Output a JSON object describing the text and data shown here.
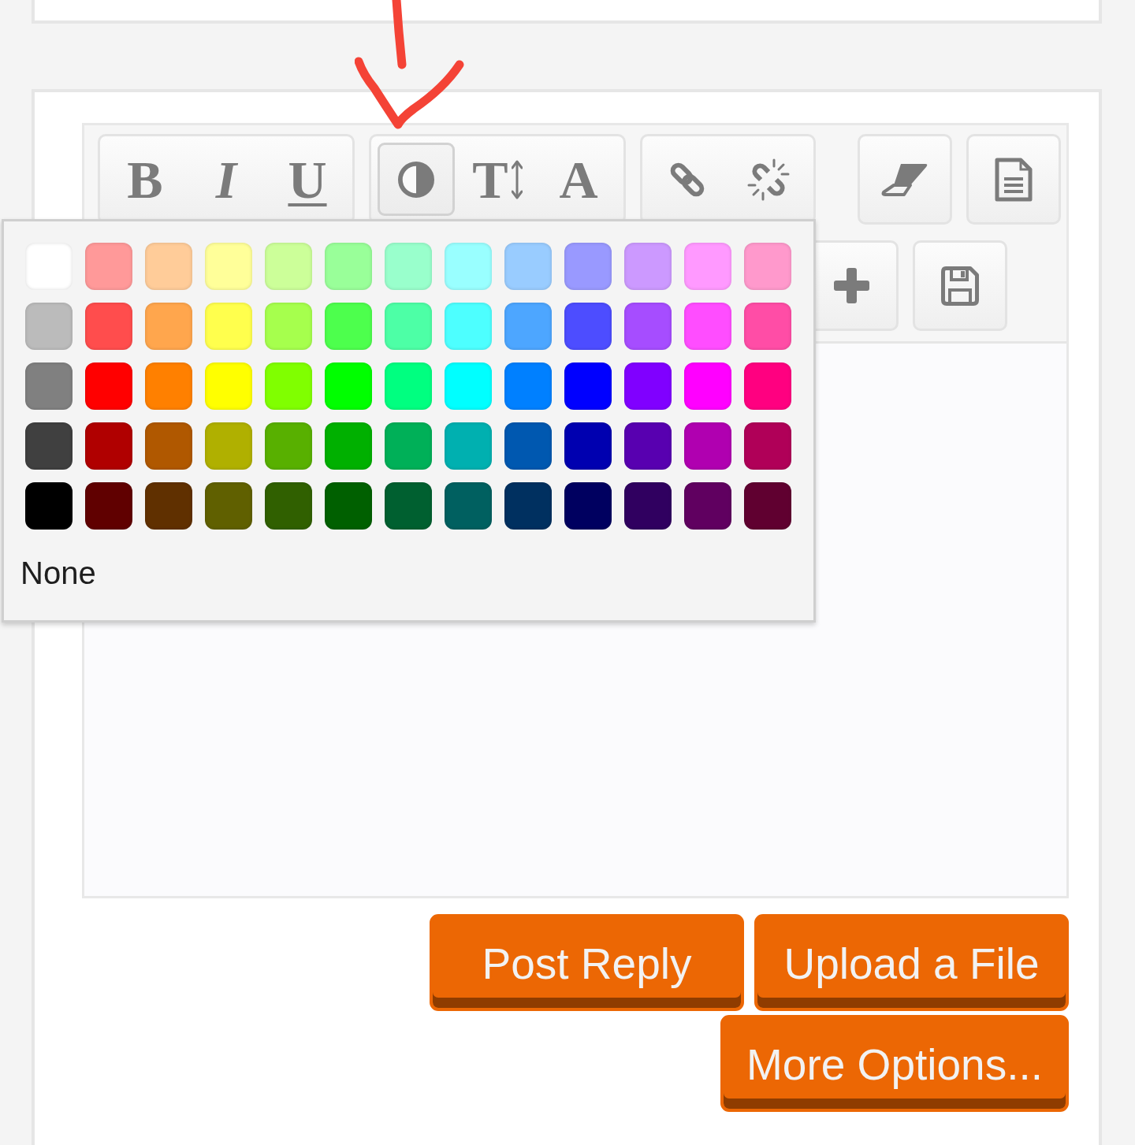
{
  "toolbar": {
    "rows": [
      {
        "groups": [
          {
            "buttons": [
              {
                "kind": "bold",
                "label": "B",
                "pressed": false
              },
              {
                "kind": "italic",
                "label": "I",
                "pressed": false
              },
              {
                "kind": "underline",
                "label": "U",
                "pressed": false
              }
            ]
          },
          {
            "buttons": [
              {
                "kind": "color",
                "pressed": true
              },
              {
                "kind": "size",
                "label": "T",
                "pressed": false
              },
              {
                "kind": "font",
                "label": "A",
                "pressed": false
              }
            ]
          },
          {
            "buttons": [
              {
                "kind": "link",
                "pressed": false
              },
              {
                "kind": "unlink",
                "pressed": false
              }
            ]
          },
          {
            "buttons": [
              {
                "kind": "eraser",
                "pressed": false
              }
            ]
          },
          {
            "buttons": [
              {
                "kind": "source",
                "pressed": false
              }
            ]
          }
        ]
      },
      {
        "groups": [
          {
            "buttons": [
              {
                "kind": "add",
                "pressed": false
              }
            ]
          },
          {
            "buttons": [
              {
                "kind": "save",
                "pressed": false
              }
            ]
          }
        ]
      }
    ]
  },
  "color_palette": {
    "rows": [
      {
        "swatches": [
          {
            "color": "#ffffff"
          },
          {
            "color": "#ff9999"
          },
          {
            "color": "#ffcc99"
          },
          {
            "color": "#ffff99"
          },
          {
            "color": "#ccff99"
          },
          {
            "color": "#99ff99"
          },
          {
            "color": "#99ffcc"
          },
          {
            "color": "#99ffff"
          },
          {
            "color": "#99ccff"
          },
          {
            "color": "#9999ff"
          },
          {
            "color": "#cc99ff"
          },
          {
            "color": "#ff99ff"
          },
          {
            "color": "#ff99cc"
          }
        ]
      },
      {
        "swatches": [
          {
            "color": "#bbbbbb"
          },
          {
            "color": "#ff4d4d"
          },
          {
            "color": "#ffa64d"
          },
          {
            "color": "#ffff4d"
          },
          {
            "color": "#a6ff4d"
          },
          {
            "color": "#4dff4d"
          },
          {
            "color": "#4dffa6"
          },
          {
            "color": "#4dffff"
          },
          {
            "color": "#4da6ff"
          },
          {
            "color": "#4d4dff"
          },
          {
            "color": "#a64dff"
          },
          {
            "color": "#ff4dff"
          },
          {
            "color": "#ff4da6"
          }
        ]
      },
      {
        "swatches": [
          {
            "color": "#808080"
          },
          {
            "color": "#ff0000"
          },
          {
            "color": "#ff8000"
          },
          {
            "color": "#ffff00"
          },
          {
            "color": "#80ff00"
          },
          {
            "color": "#00ff00"
          },
          {
            "color": "#00ff80"
          },
          {
            "color": "#00ffff"
          },
          {
            "color": "#0080ff"
          },
          {
            "color": "#0000ff"
          },
          {
            "color": "#8000ff"
          },
          {
            "color": "#ff00ff"
          },
          {
            "color": "#ff0080"
          }
        ]
      },
      {
        "swatches": [
          {
            "color": "#404040"
          },
          {
            "color": "#b00000"
          },
          {
            "color": "#b05800"
          },
          {
            "color": "#b0b000"
          },
          {
            "color": "#58b000"
          },
          {
            "color": "#00b000"
          },
          {
            "color": "#00b058"
          },
          {
            "color": "#00b0b0"
          },
          {
            "color": "#0058b0"
          },
          {
            "color": "#0000b0"
          },
          {
            "color": "#5800b0"
          },
          {
            "color": "#b000b0"
          },
          {
            "color": "#b00058"
          }
        ]
      },
      {
        "swatches": [
          {
            "color": "#000000"
          },
          {
            "color": "#600000"
          },
          {
            "color": "#603000"
          },
          {
            "color": "#606000"
          },
          {
            "color": "#306000"
          },
          {
            "color": "#006000"
          },
          {
            "color": "#006030"
          },
          {
            "color": "#006060"
          },
          {
            "color": "#003060"
          },
          {
            "color": "#000060"
          },
          {
            "color": "#300060"
          },
          {
            "color": "#600060"
          },
          {
            "color": "#600030"
          }
        ]
      }
    ],
    "none_label": "None"
  },
  "actions": [
    {
      "label": "Post Reply"
    },
    {
      "label": "Upload a File"
    },
    {
      "label": "More Options..."
    }
  ]
}
